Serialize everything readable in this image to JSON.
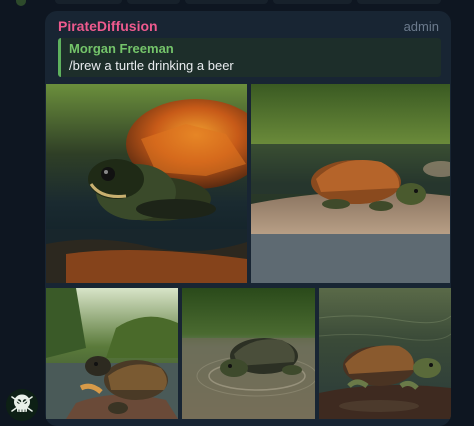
{
  "message": {
    "sender": "PirateDiffusion",
    "role_badge": "admin",
    "reply": {
      "author": "Morgan Freeman",
      "text": "/brew a turtle drinking a beer"
    }
  },
  "album": [
    {
      "id": "photo-1",
      "description": "close-up turtle drinking from water with orange shell"
    },
    {
      "id": "photo-2",
      "description": "turtle on sandy riverbank"
    },
    {
      "id": "photo-3",
      "description": "turtle on rock near river with trees"
    },
    {
      "id": "photo-4",
      "description": "turtle swimming in shallow water"
    },
    {
      "id": "photo-5",
      "description": "turtle on rock in calm water"
    }
  ],
  "colors": {
    "background": "#0e1621",
    "bubble": "#182533",
    "sender_name": "#ee5a8e",
    "reply_accent": "#5eb15e",
    "admin_badge": "#6b7a8c"
  }
}
